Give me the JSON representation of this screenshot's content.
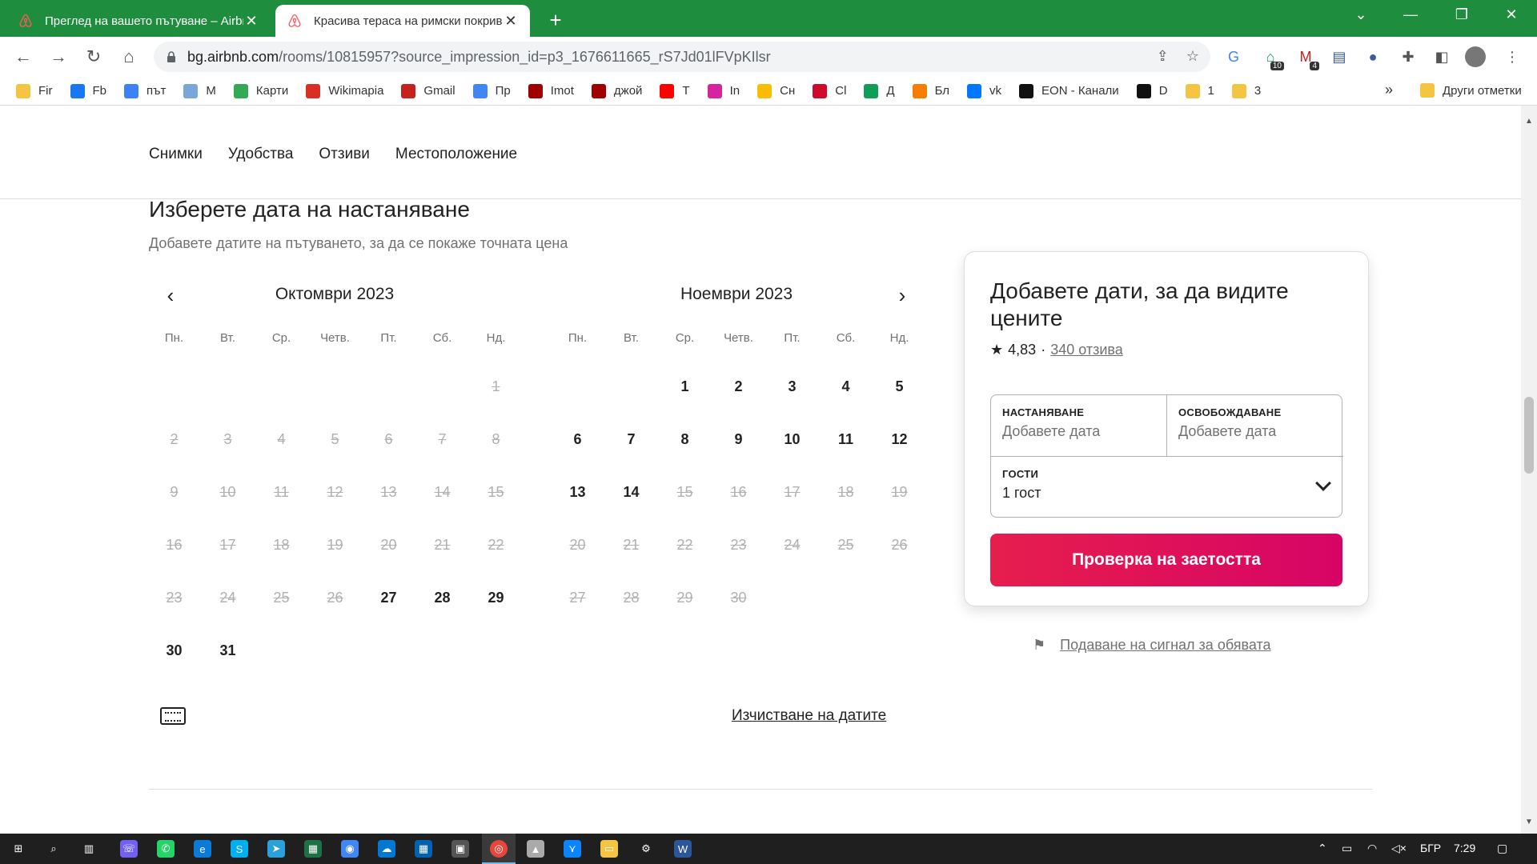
{
  "browser": {
    "tabs": [
      {
        "title": "Преглед на вашето пътуване – Airbnb",
        "active": false
      },
      {
        "title": "Красива тераса на римски покрив",
        "active": true
      }
    ],
    "new_tab": "+",
    "url_host": "bg.airbnb.com",
    "url_path": "/rooms/10815957?source_impression_id=p3_1676611665_rS7Jd01lFVpKIlsr",
    "extension_badges": {
      "home": "10",
      "gmail": "4"
    },
    "bookmarks": [
      {
        "label": "Fir",
        "color": "#f4c542"
      },
      {
        "label": "Fb",
        "color": "#1877f2"
      },
      {
        "label": "път",
        "color": "#3b82f6"
      },
      {
        "label": "M",
        "color": "#7aa7d8"
      },
      {
        "label": "Карти",
        "color": "#34a853"
      },
      {
        "label": "Wikimapia",
        "color": "#d93025"
      },
      {
        "label": "Gmail",
        "color": "#c5221f"
      },
      {
        "label": "Пр",
        "color": "#4285f4"
      },
      {
        "label": "Imot",
        "color": "#a00000"
      },
      {
        "label": "джой",
        "color": "#a00000"
      },
      {
        "label": "T",
        "color": "#ff0000"
      },
      {
        "label": "In",
        "color": "#d6249f"
      },
      {
        "label": "Сн",
        "color": "#fbbc05"
      },
      {
        "label": "Cl",
        "color": "#cf0a2c"
      },
      {
        "label": "Д",
        "color": "#0f9d58"
      },
      {
        "label": "Бл",
        "color": "#f57d00"
      },
      {
        "label": "vk",
        "color": "#0077ff"
      },
      {
        "label": "EON - Канали",
        "color": "#111111"
      },
      {
        "label": "D",
        "color": "#111111"
      },
      {
        "label": "1",
        "color": "#f4c542"
      },
      {
        "label": "3",
        "color": "#f4c542"
      }
    ],
    "more_bookmarks": "»",
    "other_bookmarks": "Други отметки"
  },
  "page": {
    "subnav": [
      "Снимки",
      "Удобства",
      "Отзиви",
      "Местоположение"
    ],
    "section_title": "Изберете дата на настаняване",
    "section_subtitle": "Добавете датите на пътуването, за да се покаже точната цена",
    "weekdays": [
      "Пн.",
      "Вт.",
      "Ср.",
      "Четв.",
      "Пт.",
      "Сб.",
      "Нд."
    ],
    "months": [
      {
        "title": "Октомври 2023",
        "offset": 6,
        "days": [
          {
            "d": "1",
            "s": "past"
          },
          {
            "d": "2",
            "s": "past"
          },
          {
            "d": "3",
            "s": "past"
          },
          {
            "d": "4",
            "s": "past"
          },
          {
            "d": "5",
            "s": "past"
          },
          {
            "d": "6",
            "s": "past"
          },
          {
            "d": "7",
            "s": "past"
          },
          {
            "d": "8",
            "s": "past"
          },
          {
            "d": "9",
            "s": "past"
          },
          {
            "d": "10",
            "s": "past"
          },
          {
            "d": "11",
            "s": "past"
          },
          {
            "d": "12",
            "s": "past"
          },
          {
            "d": "13",
            "s": "past"
          },
          {
            "d": "14",
            "s": "past"
          },
          {
            "d": "15",
            "s": "past"
          },
          {
            "d": "16",
            "s": "past"
          },
          {
            "d": "17",
            "s": "past"
          },
          {
            "d": "18",
            "s": "past"
          },
          {
            "d": "19",
            "s": "past"
          },
          {
            "d": "20",
            "s": "past"
          },
          {
            "d": "21",
            "s": "past"
          },
          {
            "d": "22",
            "s": "past"
          },
          {
            "d": "23",
            "s": "past"
          },
          {
            "d": "24",
            "s": "past"
          },
          {
            "d": "25",
            "s": "past"
          },
          {
            "d": "26",
            "s": "past"
          },
          {
            "d": "27",
            "s": "avail"
          },
          {
            "d": "28",
            "s": "avail"
          },
          {
            "d": "29",
            "s": "avail"
          },
          {
            "d": "30",
            "s": "avail"
          },
          {
            "d": "31",
            "s": "avail"
          }
        ]
      },
      {
        "title": "Ноември 2023",
        "offset": 2,
        "days": [
          {
            "d": "1",
            "s": "avail"
          },
          {
            "d": "2",
            "s": "avail"
          },
          {
            "d": "3",
            "s": "avail"
          },
          {
            "d": "4",
            "s": "avail"
          },
          {
            "d": "5",
            "s": "avail"
          },
          {
            "d": "6",
            "s": "avail"
          },
          {
            "d": "7",
            "s": "avail"
          },
          {
            "d": "8",
            "s": "avail"
          },
          {
            "d": "9",
            "s": "avail"
          },
          {
            "d": "10",
            "s": "avail"
          },
          {
            "d": "11",
            "s": "avail"
          },
          {
            "d": "12",
            "s": "avail"
          },
          {
            "d": "13",
            "s": "avail"
          },
          {
            "d": "14",
            "s": "avail"
          },
          {
            "d": "15",
            "s": "past"
          },
          {
            "d": "16",
            "s": "past"
          },
          {
            "d": "17",
            "s": "past"
          },
          {
            "d": "18",
            "s": "past"
          },
          {
            "d": "19",
            "s": "past"
          },
          {
            "d": "20",
            "s": "past"
          },
          {
            "d": "21",
            "s": "past"
          },
          {
            "d": "22",
            "s": "past"
          },
          {
            "d": "23",
            "s": "past"
          },
          {
            "d": "24",
            "s": "past"
          },
          {
            "d": "25",
            "s": "past"
          },
          {
            "d": "26",
            "s": "past"
          },
          {
            "d": "27",
            "s": "past"
          },
          {
            "d": "28",
            "s": "past"
          },
          {
            "d": "29",
            "s": "past"
          },
          {
            "d": "30",
            "s": "past"
          }
        ]
      }
    ],
    "clear_dates": "Изчистване на датите",
    "card": {
      "title": "Добавете дати, за да видите цените",
      "rating": "4,83",
      "separator": "·",
      "reviews": "340 отзива",
      "checkin_label": "НАСТАНЯВАНЕ",
      "checkin_placeholder": "Добавете дата",
      "checkout_label": "ОСВОБОЖДАВАНЕ",
      "checkout_placeholder": "Добавете дата",
      "guests_label": "ГОСТИ",
      "guests_value": "1 гост",
      "cta": "Проверка на заетостта",
      "accent": "#e61e4d"
    },
    "report": "Подаване на сигнал за обявата"
  },
  "taskbar": {
    "lang": "БГР",
    "time": "7:29"
  }
}
